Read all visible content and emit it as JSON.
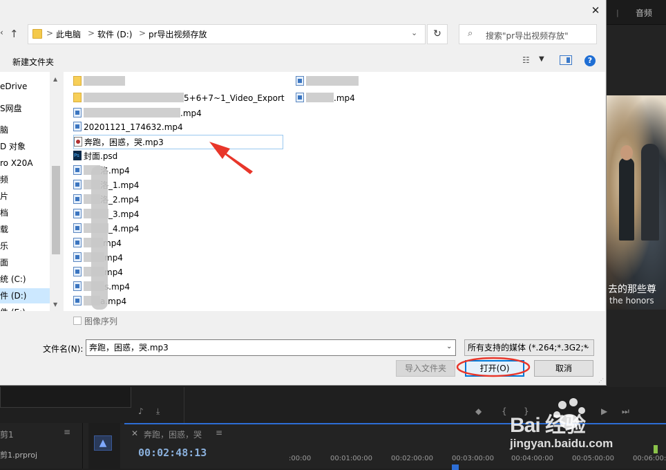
{
  "dialog": {
    "close_label": "✕",
    "address_bar": {
      "crumbs": [
        "此电脑",
        "软件 (D:)",
        "pr导出视频存放"
      ],
      "separator": ">"
    },
    "search_placeholder": "搜索\"pr导出视频存放\"",
    "toolbar": {
      "new_folder_label": "新建文件夹",
      "help_label": "?"
    },
    "nav_tree": {
      "items": [
        {
          "label": "eDrive"
        },
        {
          "label": "S网盘"
        },
        {
          "label": "脑"
        },
        {
          "label": "D 对象"
        },
        {
          "label": "ro X20A"
        },
        {
          "label": "频"
        },
        {
          "label": "片"
        },
        {
          "label": "档"
        },
        {
          "label": "载"
        },
        {
          "label": "乐"
        },
        {
          "label": "面"
        },
        {
          "label": "统 (C:)"
        },
        {
          "label": "件 (D:)"
        },
        {
          "label": "件 (E:)"
        }
      ],
      "selected_index": 12
    },
    "files": [
      {
        "label": "",
        "icon": "folder-icon"
      },
      {
        "label": "5+6+7~1_Video_Export",
        "icon": "folder-icon"
      },
      {
        "label": ".mp4",
        "icon": "video-file-icon"
      },
      {
        "label": "20201121_174632.mp4",
        "icon": "video-file-icon"
      },
      {
        "label": "奔跑，困惑，哭.mp3",
        "icon": "audio-file-icon"
      },
      {
        "label": "封面.psd",
        "icon": "psd-file-icon"
      },
      {
        "label": "洛.mp4",
        "icon": "video-file-icon"
      },
      {
        "label": "洛_1.mp4",
        "icon": "video-file-icon"
      },
      {
        "label": "洛_2.mp4",
        "icon": "video-file-icon"
      },
      {
        "label": "_3.mp4",
        "icon": "video-file-icon"
      },
      {
        "label": "_4.mp4",
        "icon": "video-file-icon"
      },
      {
        "label": "mp4",
        "icon": "video-file-icon"
      },
      {
        "label": "mp4",
        "icon": "video-file-icon"
      },
      {
        "label": "mp4",
        "icon": "video-file-icon"
      },
      {
        "label": "s.mp4",
        "icon": "video-file-icon"
      },
      {
        "label": "a.mp4",
        "icon": "video-file-icon"
      }
    ],
    "files_right_column": [
      {
        "label": "",
        "icon": "video-file-icon"
      },
      {
        "label": ".mp4",
        "icon": "video-file-icon"
      }
    ],
    "selected_file_index": 4,
    "image_sequence_label": "图像序列",
    "filename_label": "文件名(N):",
    "filename_value": "奔跑，困惑，哭.mp3",
    "filetype_value": "所有支持的媒体 (*.264;*.3G2;*",
    "buttons": {
      "import_folder": "导入文件夹",
      "open": "打开(O)",
      "cancel": "取消"
    }
  },
  "premiere": {
    "top_right_tab": "音频",
    "subtitle_cn": "去的那些尊",
    "subtitle_en": "the honors",
    "project_panel_title": "剪1",
    "project_file": "剪1.prproj",
    "sequence_name": "奔跑，困惑，哭",
    "timecode": "00:02:48:13",
    "ruler_ticks": [
      ":00:00",
      "00:01:00:00",
      "00:02:00:00",
      "00:03:00:00",
      "00:04:00:00",
      "00:05:00:00",
      "00:06:00:0"
    ]
  },
  "watermark": {
    "logo_text": "Bai  经验",
    "url": "jingyan.baidu.com"
  },
  "annotation_color": "#e8362a",
  "accent_color": "#0078d7"
}
